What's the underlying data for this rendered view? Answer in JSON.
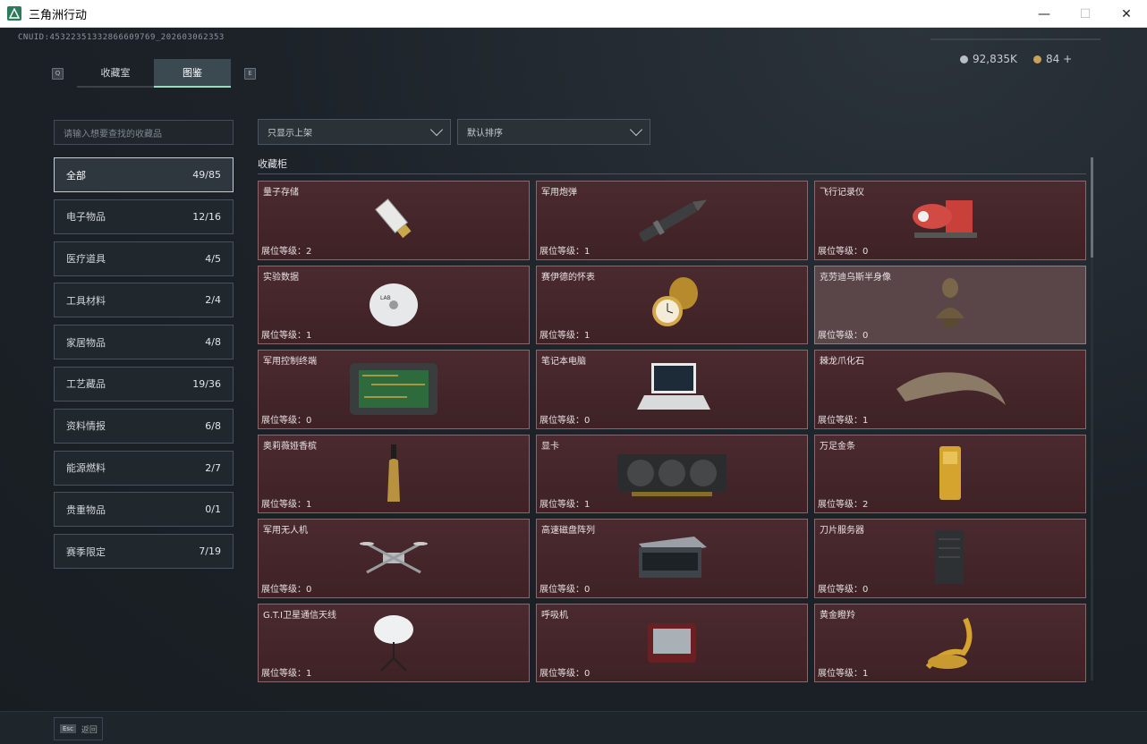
{
  "window": {
    "title": "三角洲行动",
    "controls": [
      "minimize",
      "maximize",
      "close"
    ]
  },
  "header": {
    "uid": "CNUID:4532235133286660976​9_202603062353",
    "currency": [
      {
        "icon": "silver-coin-icon",
        "value": "92,835K",
        "color": "#b8bec3"
      },
      {
        "icon": "gold-coin-icon",
        "value": "84 +",
        "color": "#c9a15a"
      }
    ]
  },
  "tabs": {
    "left_key": "Q",
    "right_key": "E",
    "items": [
      {
        "label": "收藏室",
        "active": false
      },
      {
        "label": "图鉴",
        "active": true
      }
    ]
  },
  "search": {
    "placeholder": "请输入想要查找的收藏品"
  },
  "categories": [
    {
      "label": "全部",
      "count": "49/85",
      "active": true
    },
    {
      "label": "电子物品",
      "count": "12/16"
    },
    {
      "label": "医疗道具",
      "count": "4/5"
    },
    {
      "label": "工具材料",
      "count": "2/4"
    },
    {
      "label": "家居物品",
      "count": "4/8"
    },
    {
      "label": "工艺藏品",
      "count": "19/36"
    },
    {
      "label": "资料情报",
      "count": "6/8"
    },
    {
      "label": "能源燃料",
      "count": "2/7"
    },
    {
      "label": "贵重物品",
      "count": "0/1"
    },
    {
      "label": "赛季限定",
      "count": "7/19"
    }
  ],
  "filters": {
    "show": "只显示上架",
    "sort": "默认排序"
  },
  "section": {
    "title": "收藏柜"
  },
  "level_prefix": "展位等级：",
  "items": [
    {
      "name": "量子存储",
      "level": "展位等级：2",
      "icon": "usb-drive-icon"
    },
    {
      "name": "军用炮弹",
      "level": "展位等级：1",
      "icon": "artillery-shell-icon"
    },
    {
      "name": "飞行记录仪",
      "level": "展位等级：0",
      "icon": "flight-recorder-icon"
    },
    {
      "name": "实验数据",
      "level": "展位等级：1",
      "icon": "disc-icon"
    },
    {
      "name": "赛伊德的怀表",
      "level": "展位等级：1",
      "icon": "pocket-watch-icon"
    },
    {
      "name": "克劳迪乌斯半身像",
      "level": "展位等级：0",
      "icon": "bust-icon",
      "light": true
    },
    {
      "name": "军用控制终端",
      "level": "展位等级：0",
      "icon": "circuit-board-icon"
    },
    {
      "name": "笔记本电脑",
      "level": "展位等级：0",
      "icon": "laptop-icon"
    },
    {
      "name": "棘龙爪化石",
      "level": "展位等级：1",
      "icon": "claw-fossil-icon"
    },
    {
      "name": "奥莉薇娅香槟",
      "level": "展位等级：1",
      "icon": "champagne-bottle-icon"
    },
    {
      "name": "显卡",
      "level": "展位等级：1",
      "icon": "graphics-card-icon"
    },
    {
      "name": "万足金条",
      "level": "展位等级：2",
      "icon": "gold-bar-icon"
    },
    {
      "name": "军用无人机",
      "level": "展位等级：0",
      "icon": "drone-icon"
    },
    {
      "name": "高速磁盘阵列",
      "level": "展位等级：0",
      "icon": "disk-array-icon"
    },
    {
      "name": "刀片服务器",
      "level": "展位等级：0",
      "icon": "server-icon"
    },
    {
      "name": "G.T.I卫星通信天线",
      "level": "展位等级：1",
      "icon": "satellite-dish-icon"
    },
    {
      "name": "呼吸机",
      "level": "展位等级：0",
      "icon": "ventilator-icon"
    },
    {
      "name": "黄金瞪羚",
      "level": "展位等级：1",
      "icon": "gold-gazelle-icon"
    }
  ],
  "footer": {
    "esc_key": "Esc",
    "esc_label": "返回"
  }
}
